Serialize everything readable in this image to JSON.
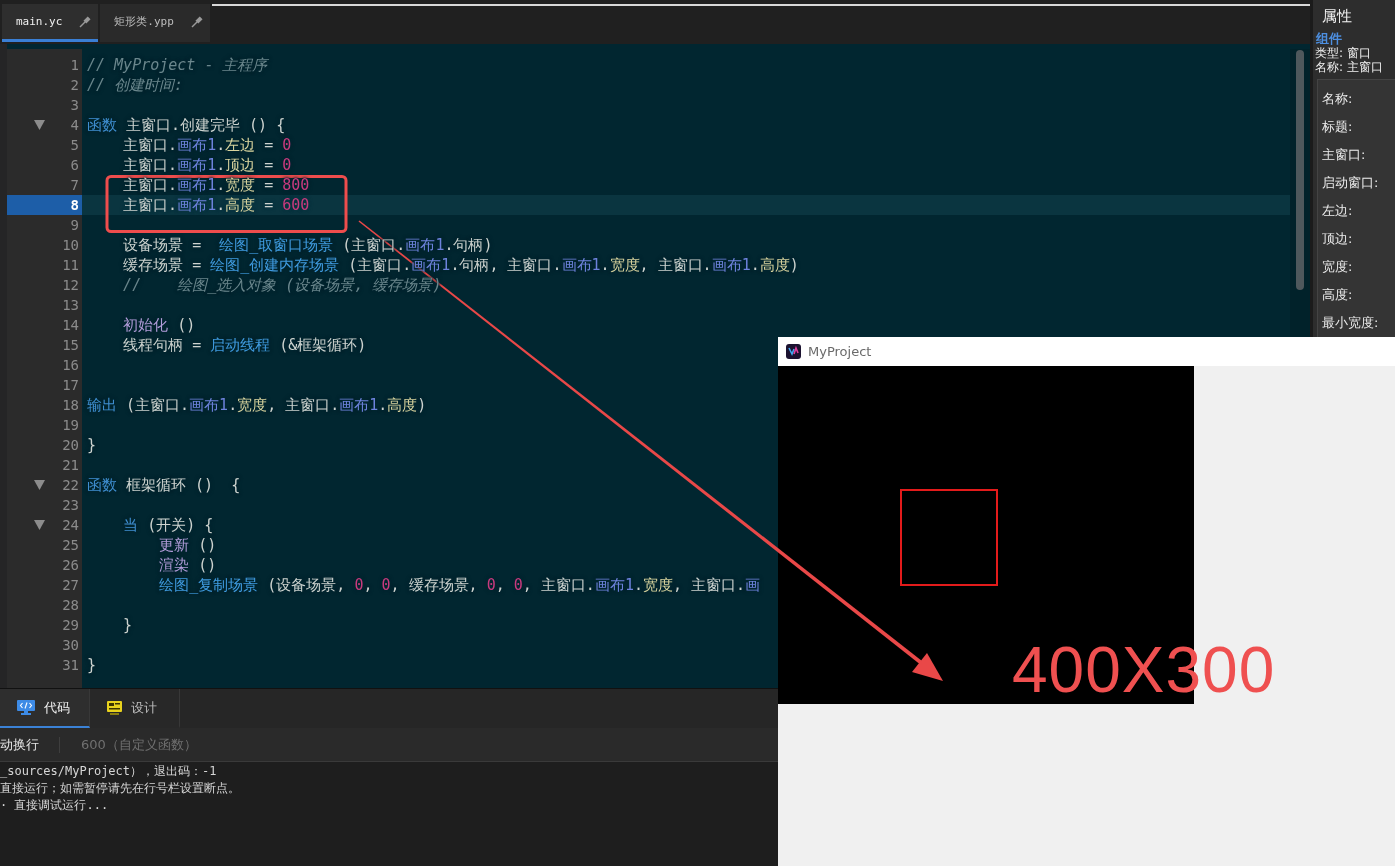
{
  "tabs": [
    {
      "label": "main.yc",
      "selected": true
    },
    {
      "label": "矩形类.ypp",
      "selected": false
    }
  ],
  "editor": {
    "lines": [
      {
        "number": "1",
        "current": false,
        "tokens": [
          {
            "text": "// MyProject - 主程序",
            "kind": "comment"
          }
        ]
      },
      {
        "number": "2",
        "current": false,
        "tokens": [
          {
            "text": "// 创建时间:",
            "kind": "comment"
          }
        ]
      },
      {
        "number": "3",
        "current": false
      },
      {
        "number": "4",
        "current": false,
        "expanded": true,
        "tokens": [
          {
            "text": "函数",
            "kind": "keyword"
          },
          {
            "text": " 主窗口.创建完毕 () {",
            "kind": "name"
          }
        ]
      },
      {
        "number": "5",
        "current": false,
        "tokens": [
          {
            "text": "    主窗口.",
            "kind": "name"
          },
          {
            "text": "画布1",
            "kind": "component"
          },
          {
            "text": ".",
            "kind": "name"
          },
          {
            "text": "左边",
            "kind": "property"
          },
          {
            "text": " = ",
            "kind": "name"
          },
          {
            "text": "0",
            "kind": "number"
          }
        ]
      },
      {
        "number": "6",
        "current": false,
        "tokens": [
          {
            "text": "    主窗口.",
            "kind": "name"
          },
          {
            "text": "画布1",
            "kind": "component"
          },
          {
            "text": ".",
            "kind": "name"
          },
          {
            "text": "顶边",
            "kind": "property"
          },
          {
            "text": " = ",
            "kind": "name"
          },
          {
            "text": "0",
            "kind": "number"
          }
        ]
      },
      {
        "number": "7",
        "current": false,
        "tokens": [
          {
            "text": "    主窗口.",
            "kind": "name"
          },
          {
            "text": "画布1",
            "kind": "component"
          },
          {
            "text": ".",
            "kind": "name"
          },
          {
            "text": "宽度",
            "kind": "property"
          },
          {
            "text": " = ",
            "kind": "name"
          },
          {
            "text": "800",
            "kind": "number"
          }
        ]
      },
      {
        "number": "8",
        "current": true,
        "tokens": [
          {
            "text": "    主窗口.",
            "kind": "name"
          },
          {
            "text": "画布1",
            "kind": "component"
          },
          {
            "text": ".",
            "kind": "name"
          },
          {
            "text": "高度",
            "kind": "property"
          },
          {
            "text": " = ",
            "kind": "name"
          },
          {
            "text": "600",
            "kind": "number"
          }
        ]
      },
      {
        "number": "9",
        "current": false
      },
      {
        "number": "10",
        "current": false,
        "tokens": [
          {
            "text": "    设备场景 =  ",
            "kind": "name"
          },
          {
            "text": "绘图_取窗口场景",
            "kind": "builtin"
          },
          {
            "text": " (主窗口.",
            "kind": "name"
          },
          {
            "text": "画布1",
            "kind": "component"
          },
          {
            "text": ".句柄)",
            "kind": "name"
          }
        ]
      },
      {
        "number": "11",
        "current": false,
        "tokens": [
          {
            "text": "    缓存场景 = ",
            "kind": "name"
          },
          {
            "text": "绘图_创建内存场景",
            "kind": "builtin"
          },
          {
            "text": " (主窗口.",
            "kind": "name"
          },
          {
            "text": "画布1",
            "kind": "component"
          },
          {
            "text": ".句柄, 主窗口.",
            "kind": "name"
          },
          {
            "text": "画布1",
            "kind": "component"
          },
          {
            "text": ".",
            "kind": "name"
          },
          {
            "text": "宽度",
            "kind": "property"
          },
          {
            "text": ", 主窗口.",
            "kind": "name"
          },
          {
            "text": "画布1",
            "kind": "component"
          },
          {
            "text": ".",
            "kind": "name"
          },
          {
            "text": "高度",
            "kind": "property"
          },
          {
            "text": ")",
            "kind": "name"
          }
        ]
      },
      {
        "number": "12",
        "current": false,
        "tokens": [
          {
            "text": "    //    绘图_选入对象 (设备场景, 缓存场景)",
            "kind": "comment"
          }
        ]
      },
      {
        "number": "13",
        "current": false
      },
      {
        "number": "14",
        "current": false,
        "tokens": [
          {
            "text": "    初始化",
            "kind": "call"
          },
          {
            "text": " ()",
            "kind": "name"
          }
        ]
      },
      {
        "number": "15",
        "current": false,
        "tokens": [
          {
            "text": "    线程句柄 = ",
            "kind": "name"
          },
          {
            "text": "启动线程",
            "kind": "builtin"
          },
          {
            "text": " (&框架循环)",
            "kind": "name"
          }
        ]
      },
      {
        "number": "16",
        "current": false
      },
      {
        "number": "17",
        "current": false
      },
      {
        "number": "18",
        "current": false,
        "tokens": [
          {
            "text": "输出",
            "kind": "keyword"
          },
          {
            "text": " (主窗口.",
            "kind": "name"
          },
          {
            "text": "画布1",
            "kind": "component"
          },
          {
            "text": ".",
            "kind": "name"
          },
          {
            "text": "宽度",
            "kind": "property"
          },
          {
            "text": ", 主窗口.",
            "kind": "name"
          },
          {
            "text": "画布1",
            "kind": "component"
          },
          {
            "text": ".",
            "kind": "name"
          },
          {
            "text": "高度",
            "kind": "property"
          },
          {
            "text": ")",
            "kind": "name"
          }
        ]
      },
      {
        "number": "19",
        "current": false
      },
      {
        "number": "20",
        "current": false,
        "tokens": [
          {
            "text": "}",
            "kind": "name"
          }
        ]
      },
      {
        "number": "21",
        "current": false
      },
      {
        "number": "22",
        "current": false,
        "expanded": true,
        "tokens": [
          {
            "text": "函数",
            "kind": "keyword"
          },
          {
            "text": " 框架循环 ()  {",
            "kind": "name"
          }
        ]
      },
      {
        "number": "23",
        "current": false
      },
      {
        "number": "24",
        "current": false,
        "expanded": true,
        "tokens": [
          {
            "text": "    当",
            "kind": "keyword"
          },
          {
            "text": " (开关) {",
            "kind": "name"
          }
        ]
      },
      {
        "number": "25",
        "current": false,
        "tokens": [
          {
            "text": "        更新",
            "kind": "call"
          },
          {
            "text": " ()",
            "kind": "name"
          }
        ]
      },
      {
        "number": "26",
        "current": false,
        "tokens": [
          {
            "text": "        渲染",
            "kind": "call"
          },
          {
            "text": " ()",
            "kind": "name"
          }
        ]
      },
      {
        "number": "27",
        "current": false,
        "tokens": [
          {
            "text": "        绘图_复制场景",
            "kind": "builtin"
          },
          {
            "text": " (设备场景, ",
            "kind": "name"
          },
          {
            "text": "0",
            "kind": "number"
          },
          {
            "text": ", ",
            "kind": "name"
          },
          {
            "text": "0",
            "kind": "number"
          },
          {
            "text": ", 缓存场景, ",
            "kind": "name"
          },
          {
            "text": "0",
            "kind": "number"
          },
          {
            "text": ", ",
            "kind": "name"
          },
          {
            "text": "0",
            "kind": "number"
          },
          {
            "text": ", 主窗口.",
            "kind": "name"
          },
          {
            "text": "画布1",
            "kind": "component"
          },
          {
            "text": ".",
            "kind": "name"
          },
          {
            "text": "宽度",
            "kind": "property"
          },
          {
            "text": ", 主窗口.",
            "kind": "name"
          },
          {
            "text": "画",
            "kind": "component"
          }
        ]
      },
      {
        "number": "28",
        "current": false
      },
      {
        "number": "29",
        "current": false,
        "tokens": [
          {
            "text": "    }",
            "kind": "name"
          }
        ]
      },
      {
        "number": "30",
        "current": false
      },
      {
        "number": "31",
        "current": false,
        "tokens": [
          {
            "text": "}",
            "kind": "name"
          }
        ]
      }
    ]
  },
  "bottom_panel": {
    "tabs": [
      {
        "label": "代码",
        "kind": "code",
        "selected": true
      },
      {
        "label": "设计",
        "kind": "design",
        "selected": false
      }
    ],
    "toolbar": {
      "option": "动换行",
      "symbol": "600（自定义函数）"
    },
    "output": [
      "_sources/MyProject），退出码：-1",
      "直接运行；如需暂停请先在行号栏设置断点。",
      "· 直接调试运行..."
    ]
  },
  "properties": {
    "title": "属性",
    "section": "组件",
    "type": "类型: 窗口",
    "name": "名称: 主窗口",
    "fields": [
      "名称:",
      "标题:",
      "主窗口:",
      "启动窗口:",
      "左边:",
      "顶边:",
      "宽度:",
      "高度:",
      "最小宽度:"
    ]
  },
  "app_window": {
    "title": "MyProject"
  },
  "annotation": {
    "text": "400X300"
  }
}
